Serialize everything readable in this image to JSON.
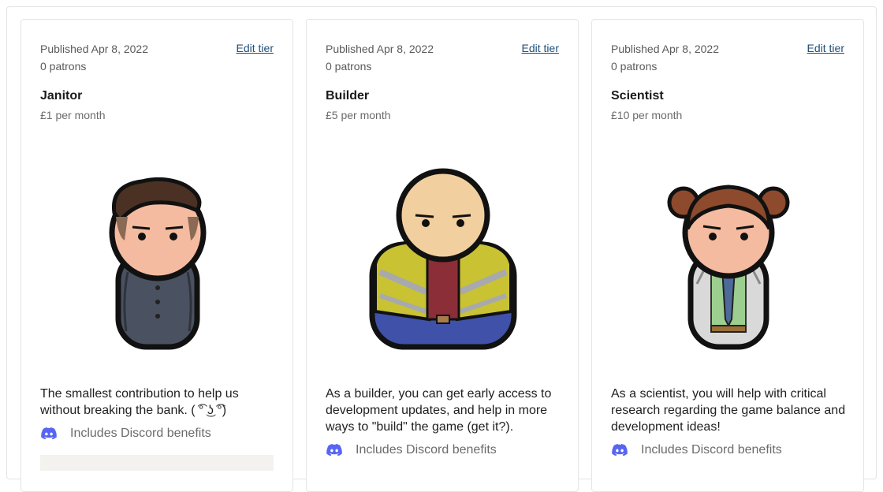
{
  "tiers": [
    {
      "published": "Published Apr 8, 2022",
      "patrons": "0 patrons",
      "edit_label": "Edit tier",
      "name": "Janitor",
      "price": "£1 per month",
      "description": "The smallest contribution to help us without breaking the bank. ( ͡° ͜ʖ ͡°)",
      "benefit_label": "Includes Discord benefits",
      "benefit_icon": "discord-icon"
    },
    {
      "published": "Published Apr 8, 2022",
      "patrons": "0 patrons",
      "edit_label": "Edit tier",
      "name": "Builder",
      "price": "£5 per month",
      "description": "As a builder, you can get early access to development updates, and help in more ways to \"build\" the game (get it?).",
      "benefit_label": "Includes Discord benefits",
      "benefit_icon": "discord-icon"
    },
    {
      "published": "Published Apr 8, 2022",
      "patrons": "0 patrons",
      "edit_label": "Edit tier",
      "name": "Scientist",
      "price": "£10 per month",
      "description": "As a scientist, you will help with critical research regarding the game balance and development ideas!",
      "benefit_label": "Includes Discord benefits",
      "benefit_icon": "discord-icon"
    }
  ],
  "colors": {
    "link": "#1f4e79",
    "discord": "#5865F2",
    "muted_text": "#6b6b6b"
  }
}
